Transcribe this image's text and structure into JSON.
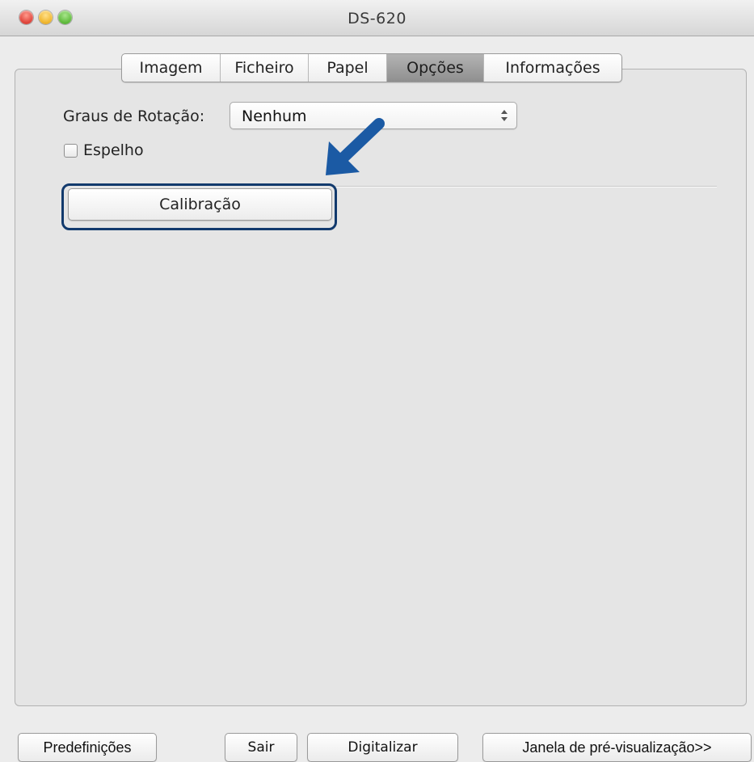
{
  "window": {
    "title": "DS-620"
  },
  "tabs": [
    {
      "label": "Imagem",
      "active": false
    },
    {
      "label": "Ficheiro",
      "active": false
    },
    {
      "label": "Papel",
      "active": false
    },
    {
      "label": "Opções",
      "active": true
    },
    {
      "label": "Informações",
      "active": false
    }
  ],
  "options": {
    "rotation_label": "Graus de Rotação:",
    "rotation_value": "Nenhum",
    "mirror_label": "Espelho",
    "mirror_checked": false,
    "calibration_label": "Calibração"
  },
  "annotation": {
    "arrow_color": "#1b5aa4",
    "highlight_color": "#123a6d"
  },
  "footer": {
    "presets_label": "Predefinições",
    "exit_label": "Sair",
    "scan_label": "Digitalizar",
    "preview_label": "Janela de pré-visualização>>"
  }
}
